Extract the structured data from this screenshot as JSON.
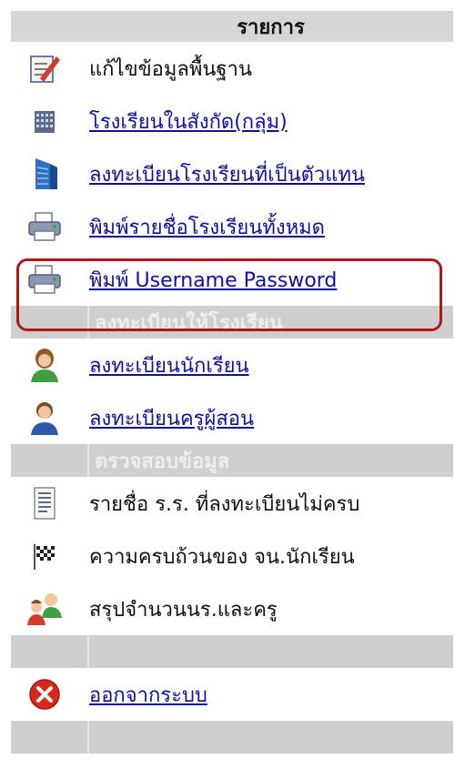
{
  "menu": {
    "header": "รายการ",
    "items": [
      {
        "label": "แก้ไขข้อมูลพื้นฐาน",
        "icon": "edit-document-icon"
      },
      {
        "label": "โรงเรียนในสังกัด(กลุ่ม)",
        "icon": "school-building-icon"
      },
      {
        "label": "ลงทะเบียนโรงเรียนที่เป็นตัวแทน",
        "icon": "office-building-icon"
      },
      {
        "label": "พิมพ์รายชื่อโรงเรียนทั้งหมด",
        "icon": "printer-icon"
      },
      {
        "label": "พิมพ์ Username Password",
        "icon": "printer-icon"
      }
    ],
    "section1": "ลงทะเบียนให้โรงเรียน",
    "items2": [
      {
        "label": "ลงทะเบียนนักเรียน",
        "icon": "student-icon"
      },
      {
        "label": "ลงทะเบียนครูผู้สอน",
        "icon": "teacher-icon"
      }
    ],
    "section2": "ตรวจสอบข้อมูล",
    "items3": [
      {
        "label": "รายชื่อ ร.ร. ที่ลงทะเบียนไม่ครบ",
        "icon": "list-document-icon"
      },
      {
        "label": "ความครบถ้วนของ จน.นักเรียน",
        "icon": "checkered-flag-icon"
      },
      {
        "label": "สรุปจำนวนนร.และครู",
        "icon": "group-icon"
      }
    ],
    "logout": {
      "label": "ออกจากระบบ",
      "icon": "close-circle-icon"
    }
  },
  "colors": {
    "link": "#1010a0",
    "highlight": "#b01818",
    "section": "#cfcfcf"
  }
}
